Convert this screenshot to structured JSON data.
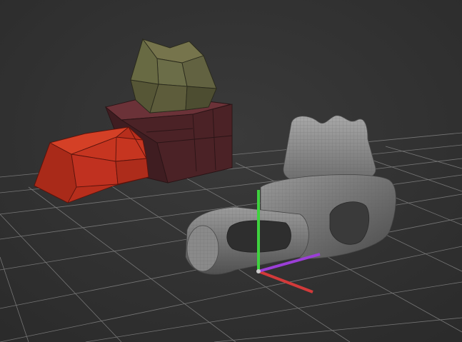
{
  "viewport": {
    "kind": "3d-modeling-viewport",
    "background_color": "#333333",
    "grid_color": "#9a9a9a"
  },
  "objects": [
    {
      "name": "lowpoly-red-block",
      "color": "#c8321f",
      "style": "faceted low-poly with wireframe"
    },
    {
      "name": "lowpoly-maroon-block",
      "color": "#5a2a2e",
      "style": "faceted low-poly with wireframe"
    },
    {
      "name": "lowpoly-olive-block",
      "color": "#6a6a45",
      "style": "faceted low-poly with wireframe"
    },
    {
      "name": "subdivided-gray-mesh",
      "color": "#7a7a7a",
      "style": "smooth subdivided mesh with dense wireframe"
    }
  ],
  "gizmo": {
    "axes": [
      {
        "name": "y-axis",
        "color": "#3fd13f"
      },
      {
        "name": "x-axis",
        "color": "#d23a3a"
      },
      {
        "name": "z-axis",
        "color": "#9b3fd6"
      }
    ]
  }
}
